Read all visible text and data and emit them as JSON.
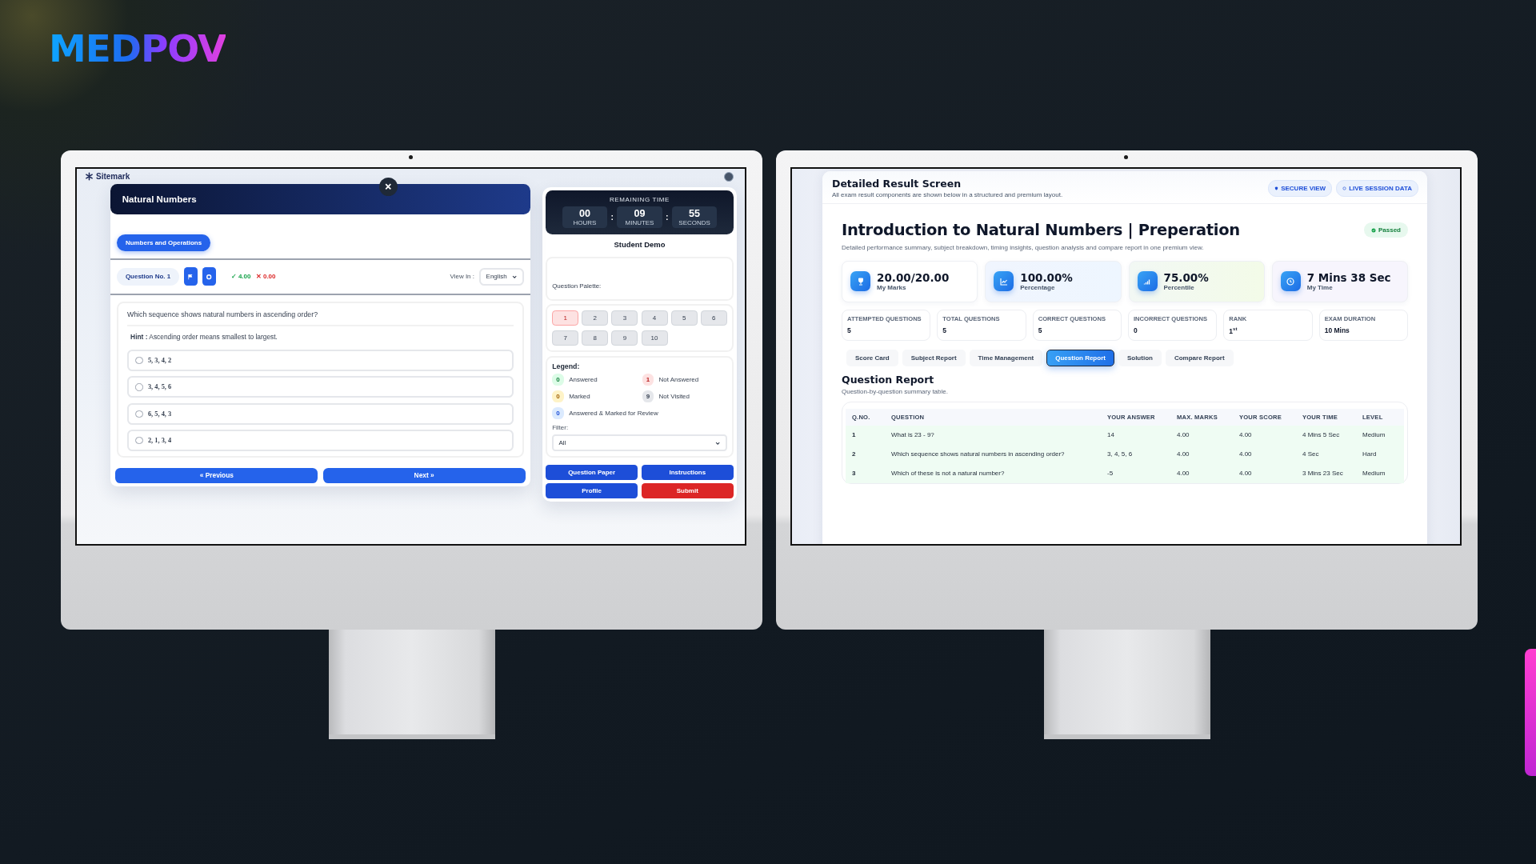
{
  "brand": {
    "logo": "MEDPOV"
  },
  "left_screen": {
    "site_logo": "Sitemark",
    "quiz": {
      "title": "Natural Numbers",
      "section": "Numbers and Operations",
      "question_no": "Question No. 1",
      "positive_marks": "✓ 4.00",
      "negative_marks": "✕ 0.00",
      "view_in_label": "View In :",
      "language": "English",
      "question": "Which sequence shows natural numbers in ascending order?",
      "hint": "**Hint :** Ascending order means smallest to largest.",
      "options": [
        {
          "label": "5, 3, 4, 2",
          "selected": false
        },
        {
          "label": "3, 4, 5, 6",
          "selected": false
        },
        {
          "label": "6, 5, 4, 3",
          "selected": false
        },
        {
          "label": "2, 1, 3, 4",
          "selected": false
        }
      ],
      "previous_button": "« Previous",
      "next_button": "Next »"
    },
    "panel": {
      "timer_title": "REMAINING TIME",
      "timer_separator": ":",
      "timer": [
        {
          "value": "00",
          "label": "HOURS"
        },
        {
          "value": "09",
          "label": "MINUTES"
        },
        {
          "value": "55",
          "label": "SECONDS"
        }
      ],
      "student": "Student Demo",
      "palette_title": "Question Palette:",
      "palette": [
        {
          "label": "1",
          "kind": "unanswered"
        },
        {
          "label": "2",
          "kind": "unvisited"
        },
        {
          "label": "3",
          "kind": "unvisited"
        },
        {
          "label": "4",
          "kind": "unvisited"
        },
        {
          "label": "5",
          "kind": "unvisited"
        },
        {
          "label": "6",
          "kind": "unvisited"
        },
        {
          "label": "7",
          "kind": "unvisited"
        },
        {
          "label": "8",
          "kind": "unvisited"
        },
        {
          "label": "9",
          "kind": "unvisited"
        },
        {
          "label": "10",
          "kind": "unvisited"
        }
      ],
      "legend_title": "Legend:",
      "legend": [
        {
          "count": "0",
          "label": "Answered",
          "kind": "answered"
        },
        {
          "count": "1",
          "label": "Not Answered",
          "kind": "unanswered"
        },
        {
          "count": "0",
          "label": "Marked",
          "kind": "marked"
        },
        {
          "count": "9",
          "label": "Not Visited",
          "kind": "unvisited"
        },
        {
          "count": "0",
          "label": "Answered & Marked for Review",
          "kind": "reviewed"
        }
      ],
      "filter_label": "Filter:",
      "filter_value": "All",
      "buttons": [
        {
          "label": "Question Paper",
          "kind": "primary"
        },
        {
          "label": "Instructions",
          "kind": "primary"
        },
        {
          "label": "Profile",
          "kind": "primary"
        },
        {
          "label": "Submit",
          "kind": "danger"
        }
      ]
    }
  },
  "right_screen": {
    "header": {
      "title": "Detailed Result Screen",
      "subtitle": "All exam result components are shown below in a structured and premium layout.",
      "badges": [
        "SECURE VIEW",
        "LIVE SESSION DATA"
      ]
    },
    "exam": {
      "title": "Introduction to Natural Numbers | Preperation",
      "status": "Passed",
      "description": "Detailed performance summary, subject breakdown, timing insights, question analysis and compare report in one premium view."
    },
    "stats": [
      {
        "value": "20.00/20.00",
        "label": "My Marks"
      },
      {
        "value": "100.00%",
        "label": "Percentage"
      },
      {
        "value": "75.00%",
        "label": "Percentile"
      },
      {
        "value": "7 Mins 38 Sec",
        "label": "My Time"
      }
    ],
    "summary": [
      {
        "label": "ATTEMPTED QUESTIONS",
        "value": "5"
      },
      {
        "label": "TOTAL QUESTIONS",
        "value": "5"
      },
      {
        "label": "CORRECT QUESTIONS",
        "value": "5"
      },
      {
        "label": "INCORRECT QUESTIONS",
        "value": "0"
      },
      {
        "label": "RANK",
        "value": "1$^{st}$"
      },
      {
        "label": "EXAM DURATION",
        "value": "10 Mins"
      }
    ],
    "tabs": [
      {
        "label": "Score Card",
        "selected": false
      },
      {
        "label": "Subject Report",
        "selected": false
      },
      {
        "label": "Time Management",
        "selected": false
      },
      {
        "label": "Question Report",
        "selected": true
      },
      {
        "label": "Solution",
        "selected": false
      },
      {
        "label": "Compare Report",
        "selected": false
      }
    ],
    "section": {
      "title": "Question Report",
      "subtitle": "Question-by-question summary table."
    },
    "table": {
      "columns": [
        "Q.NO.",
        "QUESTION",
        "YOUR ANSWER",
        "MAX. MARKS",
        "YOUR SCORE",
        "YOUR TIME",
        "LEVEL"
      ],
      "rows": [
        [
          "1",
          "What is 23 - 9?",
          "14",
          "4.00",
          "4.00",
          "4 Mins 5 Sec",
          "Medium"
        ],
        [
          "2",
          "Which sequence shows natural numbers in ascending order?",
          "3, 4, 5, 6",
          "4.00",
          "4.00",
          "4 Sec",
          "Hard"
        ],
        [
          "3",
          "Which of these is not a natural number?",
          "-5",
          "4.00",
          "4.00",
          "3 Mins 23 Sec",
          "Medium"
        ]
      ]
    }
  }
}
